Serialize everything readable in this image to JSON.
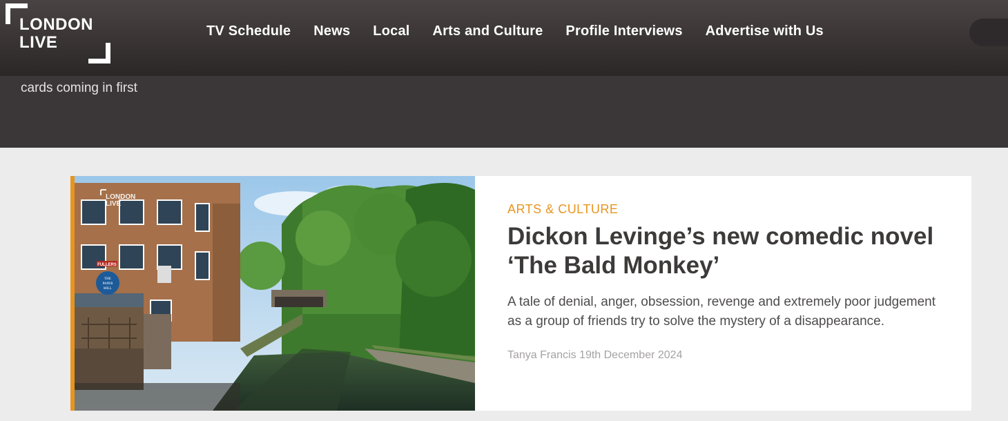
{
  "site": {
    "logo_line1": "LONDON",
    "logo_line2": "LIVE"
  },
  "nav": {
    "items": [
      {
        "label": "TV Schedule"
      },
      {
        "label": "News"
      },
      {
        "label": "Local"
      },
      {
        "label": "Arts and Culture"
      },
      {
        "label": "Profile Interviews"
      },
      {
        "label": "Advertise with Us"
      }
    ]
  },
  "hero": {
    "partial_text": "cards coming in first"
  },
  "article": {
    "category": "ARTS & CULTURE",
    "headline": "Dickon Levinge’s new comedic novel ‘The Bald Monkey’",
    "summary": "A tale of denial, anger, obsession, revenge and extremely poor judgement as a group of friends try to solve the mystery of a disappearance.",
    "author_date": "Tanya Francis 19th December 2024",
    "image_watermark_line1": "LONDON",
    "image_watermark_line2": "LIVE",
    "image_sign": "FULLERS",
    "image_badge_line1": "THE",
    "image_badge_line2": "PAPER",
    "image_badge_line3": "MILL"
  },
  "colors": {
    "accent": "#e8951f",
    "nav_bg": "#2b2727",
    "hero_bg": "#3b3637",
    "page_bg": "#ececec"
  }
}
